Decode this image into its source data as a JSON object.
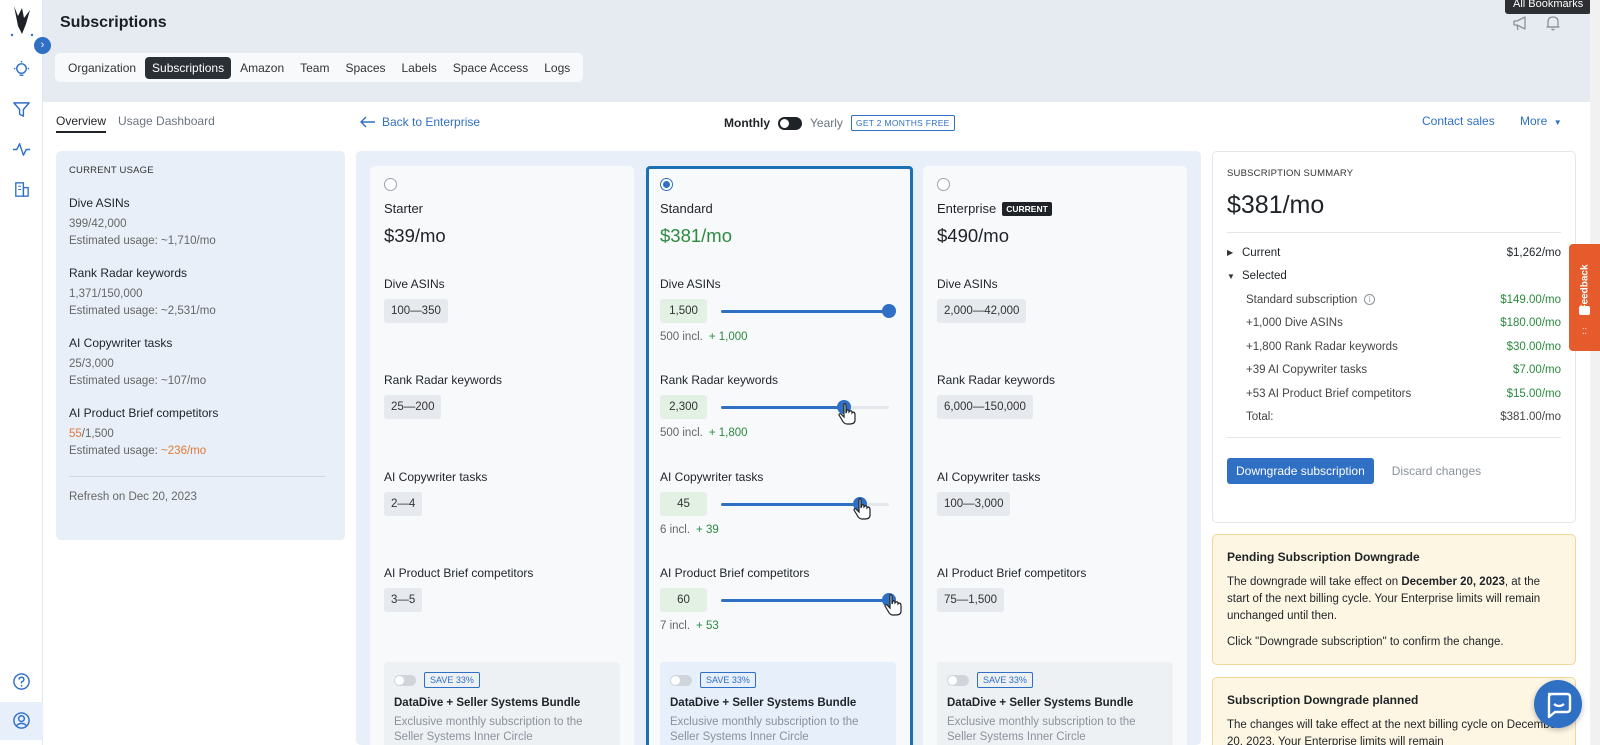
{
  "header": {
    "title": "Subscriptions",
    "bookmarks_tooltip": "All Bookmarks",
    "tabs": [
      "Organization",
      "Subscriptions",
      "Amazon",
      "Team",
      "Spaces",
      "Labels",
      "Space Access",
      "Logs"
    ]
  },
  "subnav": {
    "tabs": [
      "Overview",
      "Usage Dashboard"
    ],
    "back_link": "Back to Enterprise",
    "monthly": "Monthly",
    "yearly": "Yearly",
    "promo": "GET 2 MONTHS FREE",
    "contact": "Contact sales",
    "more": "More"
  },
  "usage": {
    "heading": "CURRENT USAGE",
    "items": [
      {
        "title": "Dive ASINs",
        "count": "399/42,000",
        "estimate": "Estimated usage: ~1,710/mo"
      },
      {
        "title": "Rank Radar keywords",
        "count": "1,371/150,000",
        "estimate": "Estimated usage: ~2,531/mo"
      },
      {
        "title": "AI Copywriter tasks",
        "count": "25/3,000",
        "estimate": "Estimated usage: ~107/mo"
      },
      {
        "title": "AI Product Brief competitors",
        "count_used": "55",
        "count_total": "/1,500",
        "estimate_prefix": "Estimated usage: ",
        "estimate_value": "~236/mo"
      }
    ],
    "refresh": "Refresh on Dec 20, 2023"
  },
  "plans": {
    "feature_labels": [
      "Dive ASINs",
      "Rank Radar keywords",
      "AI Copywriter tasks",
      "AI Product Brief competitors"
    ],
    "starter": {
      "name": "Starter",
      "price": "$39/mo",
      "ranges": [
        "100—350",
        "25—200",
        "2—4",
        "3—5"
      ]
    },
    "standard": {
      "name": "Standard",
      "price": "$381/mo",
      "values": [
        "1,500",
        "2,300",
        "45",
        "60"
      ],
      "included": [
        "500 incl.",
        "500 incl.",
        "6 incl.",
        "7 incl."
      ],
      "added": [
        "+ 1,000",
        "+ 1,800",
        "+ 39",
        "+ 53"
      ],
      "slider_levels": [
        1.0,
        0.73,
        0.83,
        1.0
      ]
    },
    "enterprise": {
      "name": "Enterprise",
      "badge": "CURRENT",
      "price": "$490/mo",
      "ranges": [
        "2,000—42,000",
        "6,000—150,000",
        "100—3,000",
        "75—1,500"
      ]
    },
    "bundle": {
      "save": "SAVE 33%",
      "title": "DataDive + Seller Systems Bundle",
      "desc": "Exclusive monthly subscription to the Seller Systems Inner Circle"
    }
  },
  "summary": {
    "heading": "SUBSCRIPTION SUMMARY",
    "price": "$381/mo",
    "current_label": "Current",
    "current_value": "$1,262/mo",
    "selected_label": "Selected",
    "lines": [
      {
        "label": "Standard subscription",
        "value": "$149.00/mo"
      },
      {
        "label": "+1,000 Dive ASINs",
        "value": "$180.00/mo"
      },
      {
        "label": "+1,800 Rank Radar keywords",
        "value": "$30.00/mo"
      },
      {
        "label": "+39 AI Copywriter tasks",
        "value": "$7.00/mo"
      },
      {
        "label": "+53 AI Product Brief competitors",
        "value": "$15.00/mo"
      }
    ],
    "total_label": "Total:",
    "total_value": "$381.00/mo",
    "primary_button": "Downgrade subscription",
    "secondary_button": "Discard changes"
  },
  "notices": [
    {
      "title": "Pending Subscription Downgrade",
      "p1_a": "The downgrade will take effect on ",
      "p1_b": "December 20, 2023",
      "p1_c": ", at the start of the next billing cycle. Your Enterprise limits will remain unchanged until then.",
      "p2": "Click \"Downgrade subscription\" to confirm the change."
    },
    {
      "title": "Subscription Downgrade planned",
      "p1": "The changes will take effect at the next billing cycle on December 20, 2023. Your Enterprise limits will remain"
    }
  ],
  "feedback": "Feedback",
  "colors": {
    "accent": "#2f6fc4",
    "green": "#2b8a3e",
    "orange": "#e07a3a",
    "notice_bg": "#fdf6e3",
    "feedback": "#e55b2b"
  }
}
